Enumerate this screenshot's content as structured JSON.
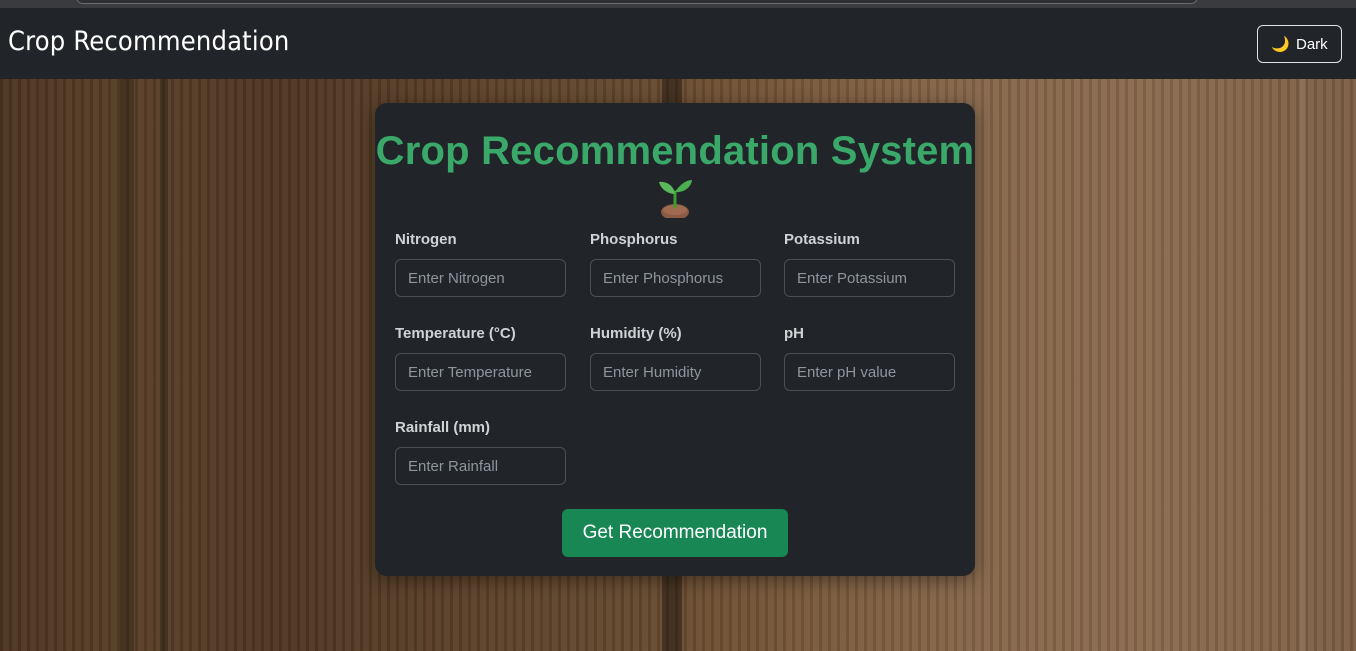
{
  "navbar": {
    "brand": "Crop Recommendation",
    "theme_toggle": {
      "label": "Dark",
      "icon": "moon-icon"
    }
  },
  "form": {
    "title": "Crop Recommendation System",
    "title_icon": "sprout-icon",
    "fields": [
      {
        "label": "Nitrogen",
        "placeholder": "Enter Nitrogen",
        "value": ""
      },
      {
        "label": "Phosphorus",
        "placeholder": "Enter Phosphorus",
        "value": ""
      },
      {
        "label": "Potassium",
        "placeholder": "Enter Potassium",
        "value": ""
      },
      {
        "label": "Temperature (°C)",
        "placeholder": "Enter Temperature",
        "value": ""
      },
      {
        "label": "Humidity (%)",
        "placeholder": "Enter Humidity",
        "value": ""
      },
      {
        "label": "pH",
        "placeholder": "Enter pH value",
        "value": ""
      },
      {
        "label": "Rainfall (mm)",
        "placeholder": "Enter Rainfall",
        "value": ""
      }
    ],
    "submit_label": "Get Recommendation"
  },
  "colors": {
    "navbar_bg": "#212529",
    "card_bg": "#212529",
    "title": "#3aa868",
    "button": "#198754",
    "moon": "#f4c542"
  }
}
